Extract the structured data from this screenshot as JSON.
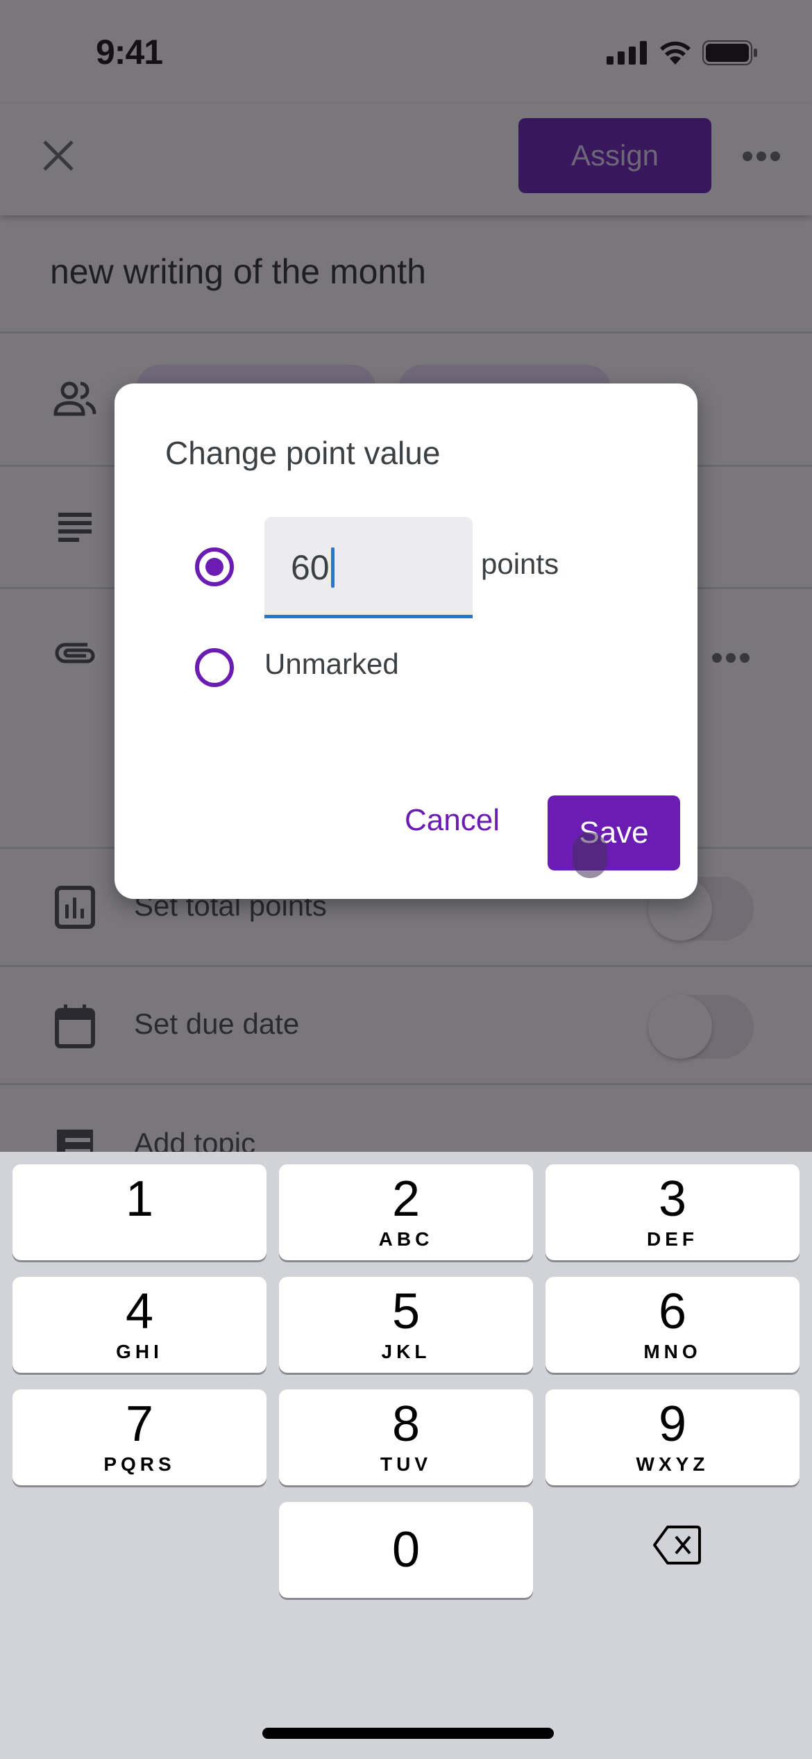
{
  "status_bar": {
    "time": "9:41"
  },
  "app_bar": {
    "close_icon": "close-icon",
    "assign_label": "Assign",
    "more_icon": "more-horiz-icon"
  },
  "form": {
    "title": "new writing of the month",
    "rows": {
      "students_icon": "people-icon",
      "description_icon": "notes-icon",
      "attachment_icon": "paperclip-icon",
      "points_label": "Set total points",
      "points_icon": "bar-chart-icon",
      "points_toggle_on": false,
      "due_label": "Set due date",
      "due_icon": "calendar-icon",
      "due_toggle_on": false,
      "topic_label": "Add topic",
      "topic_icon": "topic-list-icon"
    }
  },
  "dialog": {
    "title": "Change point value",
    "points_value": "60",
    "points_suffix": "points",
    "unmarked_label": "Unmarked",
    "selected_option": "points",
    "cancel_label": "Cancel",
    "save_label": "Save"
  },
  "keyboard": {
    "keys": [
      {
        "digit": "1",
        "letters": ""
      },
      {
        "digit": "2",
        "letters": "ABC"
      },
      {
        "digit": "3",
        "letters": "DEF"
      },
      {
        "digit": "4",
        "letters": "GHI"
      },
      {
        "digit": "5",
        "letters": "JKL"
      },
      {
        "digit": "6",
        "letters": "MNO"
      },
      {
        "digit": "7",
        "letters": "PQRS"
      },
      {
        "digit": "8",
        "letters": "TUV"
      },
      {
        "digit": "9",
        "letters": "WXYZ"
      },
      {
        "digit": "0",
        "letters": ""
      }
    ],
    "backspace_icon": "backspace-icon"
  },
  "colors": {
    "accent": "#6a1cb3",
    "focus_underline": "#2f72d0",
    "keyboard_bg": "#d1d3d9"
  }
}
